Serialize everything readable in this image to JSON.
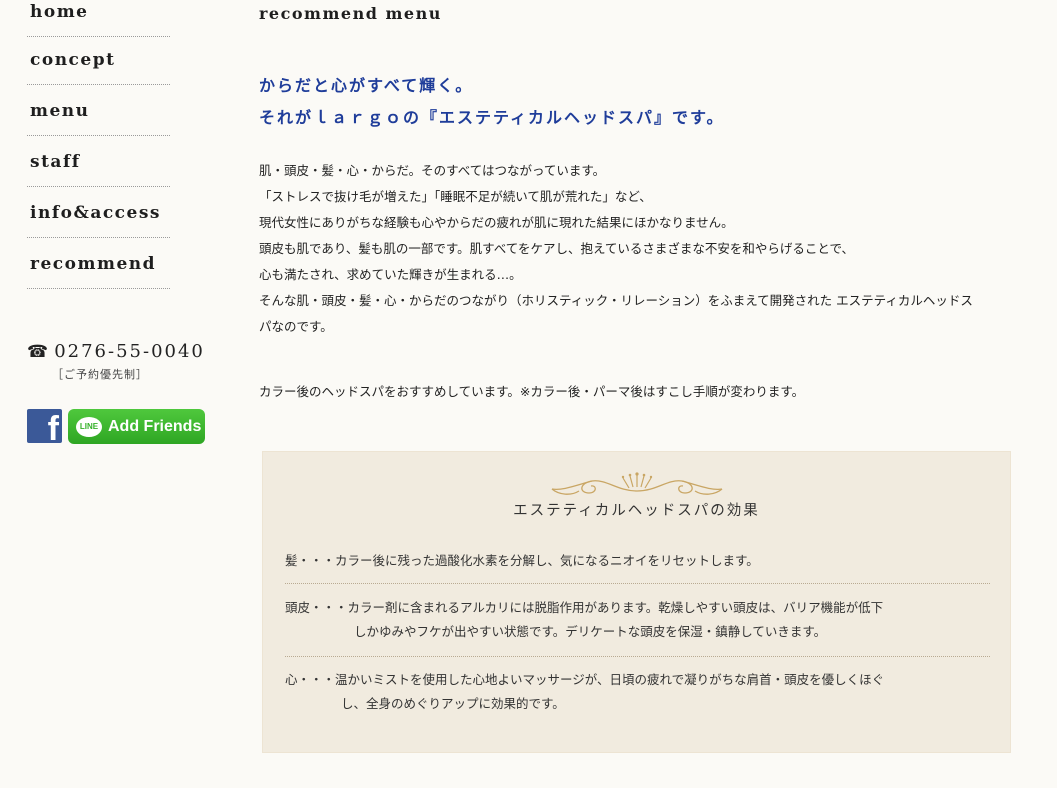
{
  "nav": {
    "items": [
      "home",
      "concept",
      "menu",
      "staff",
      "info&access",
      "recommend"
    ]
  },
  "contact": {
    "phone_icon": "phone-icon",
    "phone": "0276-55-0040",
    "note": "［ご予約優先制］"
  },
  "social": {
    "facebook_icon": "facebook-icon",
    "line_icon_text": "LINE",
    "line_label": "Add Friends",
    "colors": {
      "facebook": "#3b5998",
      "line": "#38b42c"
    }
  },
  "main": {
    "title": "recommend menu",
    "headline": [
      "からだと心がすべて輝く。",
      "それがｌａｒｇｏの『エステティカルヘッドスパ』です。"
    ],
    "headline_color": "#1f3d9a",
    "body": [
      "肌・頭皮・髪・心・からだ。そのすべてはつながっています。",
      "「ストレスで抜け毛が増えた」「睡眠不足が続いて肌が荒れた」など、",
      "現代女性にありがちな経験も心やからだの疲れが肌に現れた結果にほかなりません。",
      "頭皮も肌であり、髪も肌の一部です。肌すべてをケアし、抱えているさまざまな不安を和やらげることで、",
      "心も満たされ、求めていた輝きが生まれる…。",
      "そんな肌・頭皮・髪・心・からだのつながり（ホリスティック・リレーション）をふまえて開発された エステティカルヘッドス",
      "パなのです。"
    ],
    "note": "カラー後のヘッドスパをおすすめしています。※カラー後・パーマ後はすこし手順が変わります。"
  },
  "effects": {
    "title": "エステティカルヘッドスパの効果",
    "items": [
      {
        "line1": "髪・・・カラー後に残った過酸化水素を分解し、気になるニオイをリセットします。",
        "line2": ""
      },
      {
        "line1": "頭皮・・・カラー剤に含まれるアルカリには脱脂作用があります。乾燥しやすい頭皮は、バリア機能が低下",
        "line2": "しかゆみやフケが出やすい状態です。デリケートな頭皮を保湿・鎮静していきます。"
      },
      {
        "line1": "心・・・温かいミストを使用した心地よいマッサージが、日頃の疲れで凝りがちな肩首・頭皮を優しくほぐ",
        "line2": "し、全身のめぐりアップに効果的です。"
      }
    ]
  }
}
